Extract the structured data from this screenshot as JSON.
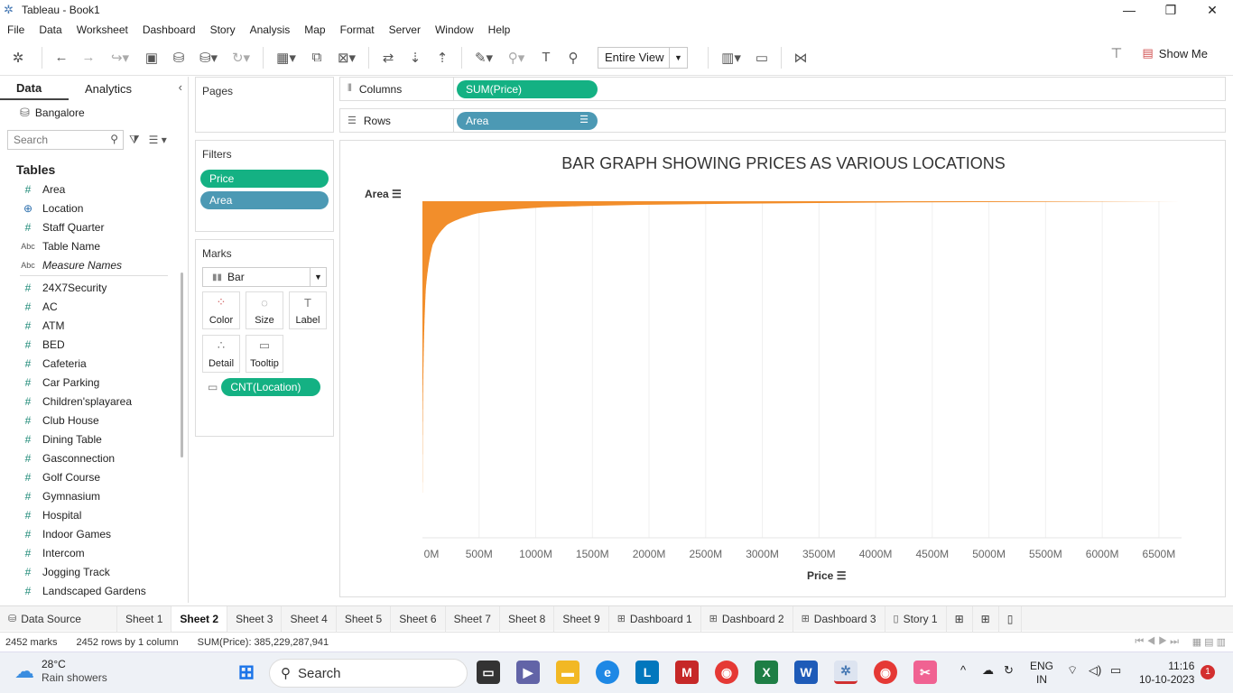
{
  "window": {
    "title": "Tableau - Book1",
    "minimize": "—",
    "restore": "❐",
    "close": "✕"
  },
  "menu": [
    "File",
    "Data",
    "Worksheet",
    "Dashboard",
    "Story",
    "Analysis",
    "Map",
    "Format",
    "Server",
    "Window",
    "Help"
  ],
  "toolbar": {
    "fit": "Entire View",
    "show_me": "Show Me"
  },
  "left": {
    "tab_data": "Data",
    "tab_analytics": "Analytics",
    "datasource": "Bangalore",
    "search_placeholder": "Search",
    "tables_heading": "Tables",
    "fields_top": [
      {
        "name": "Area",
        "type": "num"
      },
      {
        "name": "Location",
        "type": "geo"
      },
      {
        "name": "Staff Quarter",
        "type": "num"
      },
      {
        "name": "Table Name",
        "type": "abc"
      },
      {
        "name": "Measure Names",
        "type": "abc"
      }
    ],
    "fields": [
      "24X7Security",
      "AC",
      "ATM",
      "BED",
      "Cafeteria",
      "Car Parking",
      "Children'splayarea",
      "Club House",
      "Dining Table",
      "Gasconnection",
      "Golf Course",
      "Gymnasium",
      "Hospital",
      "Indoor Games",
      "Intercom",
      "Jogging Track",
      "Landscaped Gardens"
    ]
  },
  "cards": {
    "pages": "Pages",
    "filters": "Filters",
    "filter_pills": [
      "Price",
      "Area"
    ],
    "marks": "Marks",
    "mark_type": "Bar",
    "mark_buttons": [
      {
        "label": "Color",
        "icon": "color-icon"
      },
      {
        "label": "Size",
        "icon": "size-icon"
      },
      {
        "label": "Label",
        "icon": "label-icon"
      },
      {
        "label": "Detail",
        "icon": "detail-icon"
      },
      {
        "label": "Tooltip",
        "icon": "tooltip-icon"
      }
    ],
    "mark_pill": "CNT(Location)"
  },
  "shelves": {
    "columns_label": "Columns",
    "columns_pill": "SUM(Price)",
    "rows_label": "Rows",
    "rows_pill": "Area"
  },
  "chart_data": {
    "type": "bar",
    "orientation": "horizontal",
    "title": "BAR GRAPH SHOWING PRICES AS VARIOUS LOCATIONS",
    "xlabel": "Price",
    "ylabel": "Area",
    "xlim": [
      0,
      6700
    ],
    "x_unit": "M",
    "x_ticks": [
      "0M",
      "500M",
      "1000M",
      "1500M",
      "2000M",
      "2500M",
      "3000M",
      "3500M",
      "4000M",
      "4500M",
      "5000M",
      "5500M",
      "6000M",
      "6500M"
    ],
    "bar_color": "#f28e2b",
    "mark_count": 2452,
    "sorted": "descending",
    "profile": [
      [
        0.0,
        6700
      ],
      [
        0.01,
        2300
      ],
      [
        0.02,
        1100
      ],
      [
        0.04,
        500
      ],
      [
        0.08,
        220
      ],
      [
        0.15,
        90
      ],
      [
        0.3,
        30
      ],
      [
        0.6,
        8
      ],
      [
        1.0,
        1
      ]
    ]
  },
  "tabs": {
    "datasource": "Data Source",
    "sheets": [
      "Sheet 1",
      "Sheet 2",
      "Sheet 3",
      "Sheet 4",
      "Sheet 5",
      "Sheet 6",
      "Sheet 7",
      "Sheet 8",
      "Sheet 9"
    ],
    "active": "Sheet 2",
    "dashboards": [
      "Dashboard 1",
      "Dashboard 2",
      "Dashboard 3"
    ],
    "story": "Story 1"
  },
  "status": {
    "marks": "2452 marks",
    "rows": "2452 rows by 1 column",
    "sum": "SUM(Price): 385,229,287,941"
  },
  "taskbar": {
    "temp": "28°C",
    "weather": "Rain showers",
    "search": "Search",
    "lang1": "ENG",
    "lang2": "IN",
    "time": "11:16",
    "date": "10-10-2023",
    "badge": "1"
  }
}
